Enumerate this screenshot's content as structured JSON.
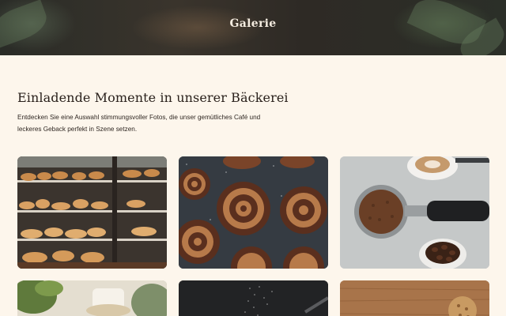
{
  "hero": {
    "title": "Galerie"
  },
  "intro": {
    "heading": "Einladende Momente in unserer Bäckerei",
    "description": "Entdecken Sie eine Auswahl stimmungsvoller Fotos, die unser gemütliches Café und leckeres Geback perfekt in Szene setzen."
  },
  "gallery": {
    "photos": [
      {
        "subject": "bakery-display-case"
      },
      {
        "subject": "cinnamon-rolls"
      },
      {
        "subject": "coffee-portafilter"
      },
      {
        "subject": "cafe-plants-cup"
      },
      {
        "subject": "flour-dark-surface"
      },
      {
        "subject": "cookies-wood-table"
      }
    ]
  }
}
